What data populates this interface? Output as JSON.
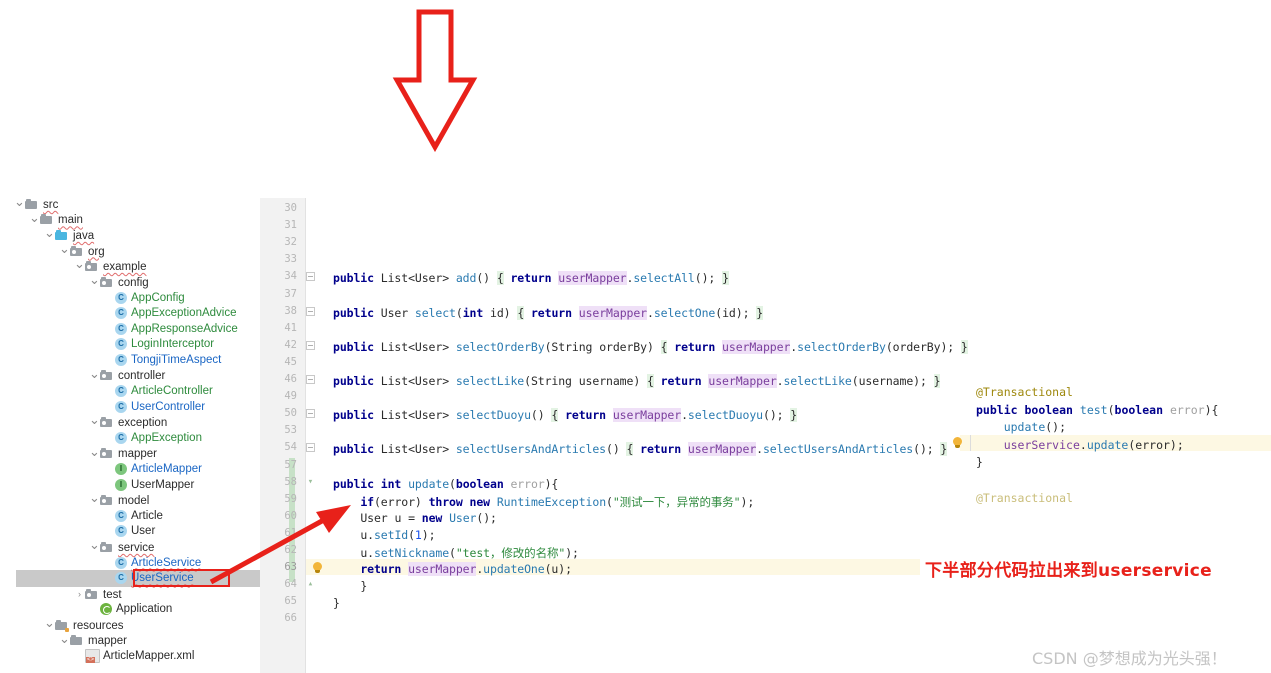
{
  "project_tree": {
    "items": [
      {
        "label": "src",
        "indent": 0,
        "twisty": "v",
        "icon": "folder-icon",
        "kind": "folder",
        "style": "dark",
        "squiggle": true
      },
      {
        "label": "main",
        "indent": 1,
        "twisty": "v",
        "icon": "folder-icon",
        "kind": "folder",
        "style": "dark",
        "squiggle": true
      },
      {
        "label": "java",
        "indent": 2,
        "twisty": "v",
        "icon": "folder-sources-icon",
        "kind": "folder-blue",
        "style": "dark",
        "squiggle": true
      },
      {
        "label": "org",
        "indent": 3,
        "twisty": "v",
        "icon": "package-icon",
        "kind": "package",
        "style": "dark",
        "squiggle": true
      },
      {
        "label": "example",
        "indent": 4,
        "twisty": "v",
        "icon": "package-icon",
        "kind": "package",
        "style": "dark",
        "squiggle": true
      },
      {
        "label": "config",
        "indent": 5,
        "twisty": "v",
        "icon": "package-icon",
        "kind": "package",
        "style": "dark",
        "squiggle": false
      },
      {
        "label": "AppConfig",
        "indent": 6,
        "twisty": "",
        "icon": "java-class-icon",
        "kind": "class",
        "style": "green",
        "squiggle": false
      },
      {
        "label": "AppExceptionAdvice",
        "indent": 6,
        "twisty": "",
        "icon": "java-class-icon",
        "kind": "class",
        "style": "green",
        "squiggle": false
      },
      {
        "label": "AppResponseAdvice",
        "indent": 6,
        "twisty": "",
        "icon": "java-class-icon",
        "kind": "class",
        "style": "green",
        "squiggle": false
      },
      {
        "label": "LoginInterceptor",
        "indent": 6,
        "twisty": "",
        "icon": "java-class-icon",
        "kind": "class",
        "style": "green",
        "squiggle": false
      },
      {
        "label": "TongjiTimeAspect",
        "indent": 6,
        "twisty": "",
        "icon": "java-class-icon",
        "kind": "class",
        "style": "blue",
        "squiggle": false
      },
      {
        "label": "controller",
        "indent": 5,
        "twisty": "v",
        "icon": "package-icon",
        "kind": "package",
        "style": "dark",
        "squiggle": false
      },
      {
        "label": "ArticleController",
        "indent": 6,
        "twisty": "",
        "icon": "java-class-icon",
        "kind": "class",
        "style": "green",
        "squiggle": false
      },
      {
        "label": "UserController",
        "indent": 6,
        "twisty": "",
        "icon": "java-class-icon",
        "kind": "class",
        "style": "blue",
        "squiggle": false
      },
      {
        "label": "exception",
        "indent": 5,
        "twisty": "v",
        "icon": "package-icon",
        "kind": "package",
        "style": "dark",
        "squiggle": false
      },
      {
        "label": "AppException",
        "indent": 6,
        "twisty": "",
        "icon": "java-class-icon",
        "kind": "class",
        "style": "green",
        "squiggle": false
      },
      {
        "label": "mapper",
        "indent": 5,
        "twisty": "v",
        "icon": "package-icon",
        "kind": "package",
        "style": "dark",
        "squiggle": false
      },
      {
        "label": "ArticleMapper",
        "indent": 6,
        "twisty": "",
        "icon": "java-interface-icon",
        "kind": "interface",
        "style": "blue",
        "squiggle": false
      },
      {
        "label": "UserMapper",
        "indent": 6,
        "twisty": "",
        "icon": "java-interface-icon",
        "kind": "interface",
        "style": "dark",
        "squiggle": false
      },
      {
        "label": "model",
        "indent": 5,
        "twisty": "v",
        "icon": "package-icon",
        "kind": "package",
        "style": "dark",
        "squiggle": false
      },
      {
        "label": "Article",
        "indent": 6,
        "twisty": "",
        "icon": "java-class-icon",
        "kind": "class",
        "style": "dark",
        "squiggle": false
      },
      {
        "label": "User",
        "indent": 6,
        "twisty": "",
        "icon": "java-class-icon",
        "kind": "class",
        "style": "dark",
        "squiggle": false
      },
      {
        "label": "service",
        "indent": 5,
        "twisty": "v",
        "icon": "package-icon",
        "kind": "package",
        "style": "dark",
        "squiggle": true
      },
      {
        "label": "ArticleService",
        "indent": 6,
        "twisty": "",
        "icon": "java-class-icon",
        "kind": "class",
        "style": "blue",
        "squiggle": true
      },
      {
        "label": "UserService",
        "indent": 6,
        "twisty": "",
        "icon": "java-class-icon",
        "kind": "class",
        "style": "blue",
        "squiggle": true
      },
      {
        "label": "test",
        "indent": 4,
        "twisty": ">",
        "icon": "package-icon",
        "kind": "package",
        "style": "dark",
        "squiggle": false
      },
      {
        "label": "Application",
        "indent": 5,
        "twisty": "",
        "icon": "spring-boot-icon",
        "kind": "spring",
        "style": "dark",
        "squiggle": false
      },
      {
        "label": "resources",
        "indent": 2,
        "twisty": "v",
        "icon": "folder-resources-icon",
        "kind": "folder-res",
        "style": "dark",
        "squiggle": false
      },
      {
        "label": "mapper",
        "indent": 3,
        "twisty": "v",
        "icon": "folder-icon",
        "kind": "folder",
        "style": "dark",
        "squiggle": false
      },
      {
        "label": "ArticleMapper.xml",
        "indent": 4,
        "twisty": "",
        "icon": "xml-file-icon",
        "kind": "xml",
        "style": "dark",
        "squiggle": false
      }
    ],
    "selected_item": "UserService",
    "highlight_color": "#c9c9c9",
    "box_color": "#e8211a"
  },
  "editor": {
    "line_numbers": [
      "30",
      "31",
      "32",
      "33",
      "34",
      "37",
      "38",
      "41",
      "42",
      "45",
      "46",
      "49",
      "50",
      "53",
      "54",
      "57",
      "58",
      "59",
      "60",
      "61",
      "62",
      "63",
      "64",
      "65",
      "66"
    ],
    "highlighted_line": "63",
    "code_lines": [
      {
        "line": "34",
        "text": "public List<User> add() { return userMapper.selectAll(); }"
      },
      {
        "line": "38",
        "text": "public User select(int id) { return userMapper.selectOne(id); }"
      },
      {
        "line": "42",
        "text": "public List<User> selectOrderBy(String orderBy) { return userMapper.selectOrderBy(orderBy); }"
      },
      {
        "line": "46",
        "text": "public List<User> selectLike(String username) { return userMapper.selectLike(username); }"
      },
      {
        "line": "50",
        "text": "public List<User> selectDuoyu() { return userMapper.selectDuoyu(); }"
      },
      {
        "line": "54",
        "text": "public List<User> selectUsersAndArticles() { return userMapper.selectUsersAndArticles(); }"
      },
      {
        "line": "58",
        "text": "public int update(boolean error){"
      },
      {
        "line": "59",
        "text": "    if(error) throw new RuntimeException(\"测试一下，异常的事务\");"
      },
      {
        "line": "60",
        "text": "    User u = new User();"
      },
      {
        "line": "61",
        "text": "    u.setId(1);"
      },
      {
        "line": "62",
        "text": "    u.setNickname(\"test，修改的名称\");"
      },
      {
        "line": "63",
        "text": "    return userMapper.updateOne(u);"
      },
      {
        "line": "64",
        "text": "    }"
      },
      {
        "line": "65",
        "text": "}"
      }
    ],
    "string_literals": [
      "\"测试一下，异常的事务\"",
      "\"test，修改的名称\""
    ],
    "field_token": "userMapper",
    "gutter_bg": "#f2f2f2",
    "change_bar_color": "#c7e1c7",
    "highlight_bg": "#fdf8e3"
  },
  "right_snippet": {
    "lines": [
      "@Transactional",
      "public boolean test(boolean error){",
      "    update();",
      "    userService.update(error);",
      "}",
      "",
      "@Transactional"
    ],
    "highlighted_line_index": 3,
    "highlight_bg": "#fdf8e3"
  },
  "annotations": {
    "down_arrow_color": "#e8211a",
    "tree_arrow_color": "#e8211a",
    "red_note": "下半部分代码拉出来到userservice",
    "red_note_color": "#e8211a",
    "watermark": "CSDN @梦想成为光头强！",
    "watermark_color": "#c4c4c4"
  }
}
